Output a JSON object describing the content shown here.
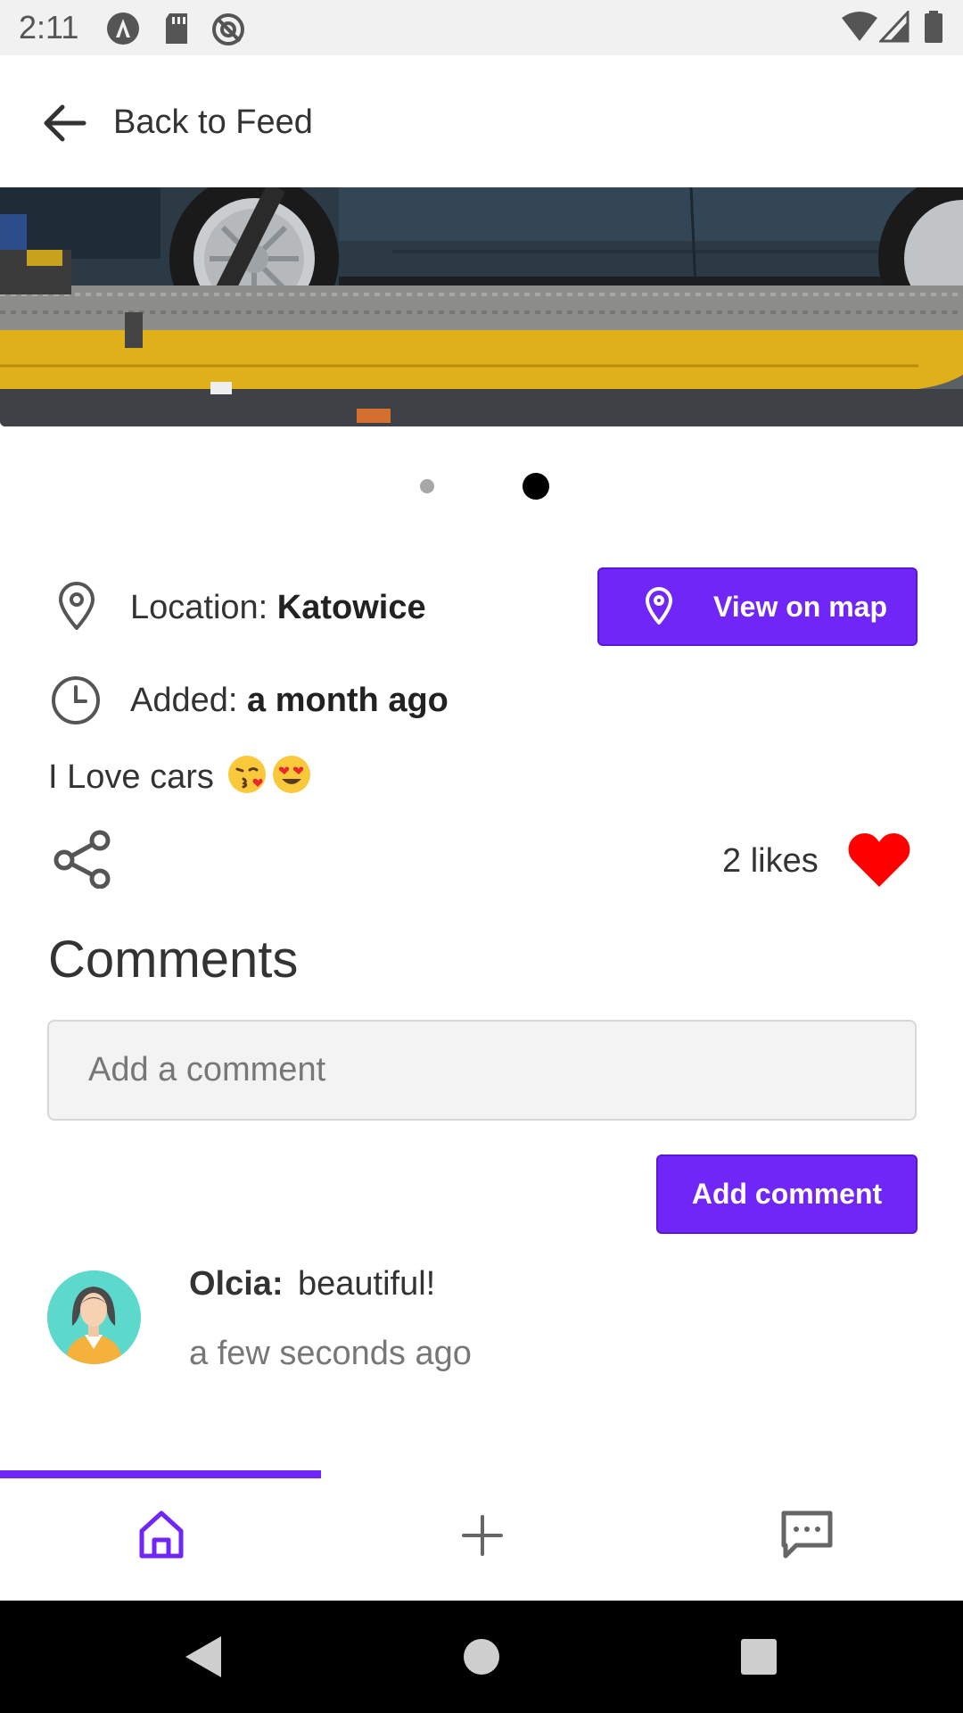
{
  "status_bar": {
    "time": "2:11",
    "icons_left": [
      "notification-a-icon",
      "sd-card-icon",
      "sync-disabled-icon"
    ],
    "icons_right": [
      "wifi-icon",
      "signal-icon",
      "battery-icon"
    ]
  },
  "header": {
    "back_label": "Back to Feed"
  },
  "carousel": {
    "slide_count": 2,
    "active_index": 1
  },
  "location": {
    "label": "Location: ",
    "value": "Katowice",
    "map_button": "View on map"
  },
  "added": {
    "label": "Added: ",
    "value": "a month ago"
  },
  "post": {
    "description": "I Love cars",
    "emojis": [
      "kissing-face-heart-emoji",
      "heart-eyes-emoji"
    ],
    "likes_text": "2 likes"
  },
  "comments": {
    "title": "Comments",
    "input_placeholder": "Add a comment",
    "add_button": "Add comment",
    "items": [
      {
        "author": "Olcia:",
        "text": "beautiful!",
        "time": "a few seconds ago"
      }
    ]
  },
  "bottom_nav": {
    "items": [
      "home-icon",
      "add-icon",
      "messages-icon"
    ],
    "active": "home-icon"
  },
  "colors": {
    "accent": "#7026f6",
    "like": "#ff0000",
    "status_bar_bg": "#f1f1f1"
  }
}
